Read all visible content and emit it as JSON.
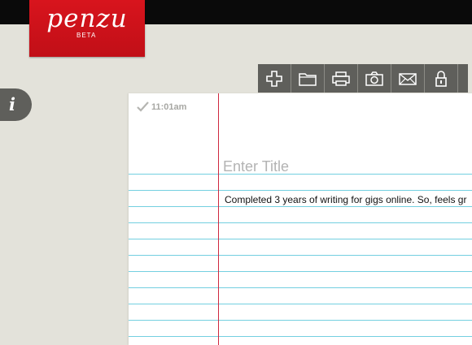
{
  "brand": {
    "name": "penzu",
    "badge": "BETA",
    "color": "#d8141d"
  },
  "info_button": {
    "glyph": "i"
  },
  "toolbar": {
    "items": [
      {
        "name": "new-entry",
        "icon": "plus-icon"
      },
      {
        "name": "open-journal",
        "icon": "folder-icon"
      },
      {
        "name": "print",
        "icon": "printer-icon"
      },
      {
        "name": "insert-photo",
        "icon": "camera-icon"
      },
      {
        "name": "email",
        "icon": "envelope-icon"
      },
      {
        "name": "lock",
        "icon": "lock-icon"
      }
    ]
  },
  "entry": {
    "time": "11:01am",
    "title_placeholder": "Enter Title",
    "title": "",
    "body": "Completed 3 years of writing for gigs online. So, feels gr",
    "rule_color": "#73cfe0",
    "margin_color": "#d0273e"
  }
}
